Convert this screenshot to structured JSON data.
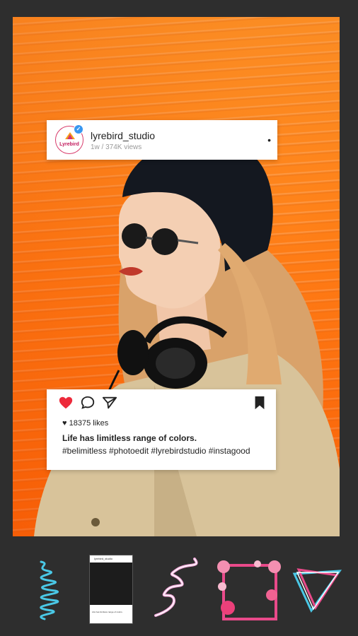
{
  "post": {
    "username": "lyrebird_studio",
    "meta": "1w / 374K views",
    "logo_text": "Lyrebird",
    "likes": "18375 likes",
    "caption": "Life has limitless range of colors.",
    "hashtags": "#belimitless #photoedit #lyrebirdstudio #instagood"
  },
  "mini_post": {
    "username": "lyrebird_studio",
    "caption": "Life has limitless range of colors."
  },
  "icons": {
    "like": "heart-icon",
    "comment": "comment-icon",
    "share": "send-icon",
    "save": "bookmark-icon",
    "verified": "verified-badge-icon",
    "more": "more-dots-icon"
  },
  "toolbar": [
    "cyan-scribble-sticker",
    "instagram-frame-sticker",
    "pink-neon-swirl-sticker",
    "pink-hearts-frame-sticker",
    "neon-triangle-sticker"
  ],
  "colors": {
    "background": "#2e2e2e",
    "orange": "#ff7e16",
    "heart": "#ed2a3b",
    "verified": "#3897f0",
    "cyan": "#4ac8e6",
    "pink": "#e94a8a"
  }
}
